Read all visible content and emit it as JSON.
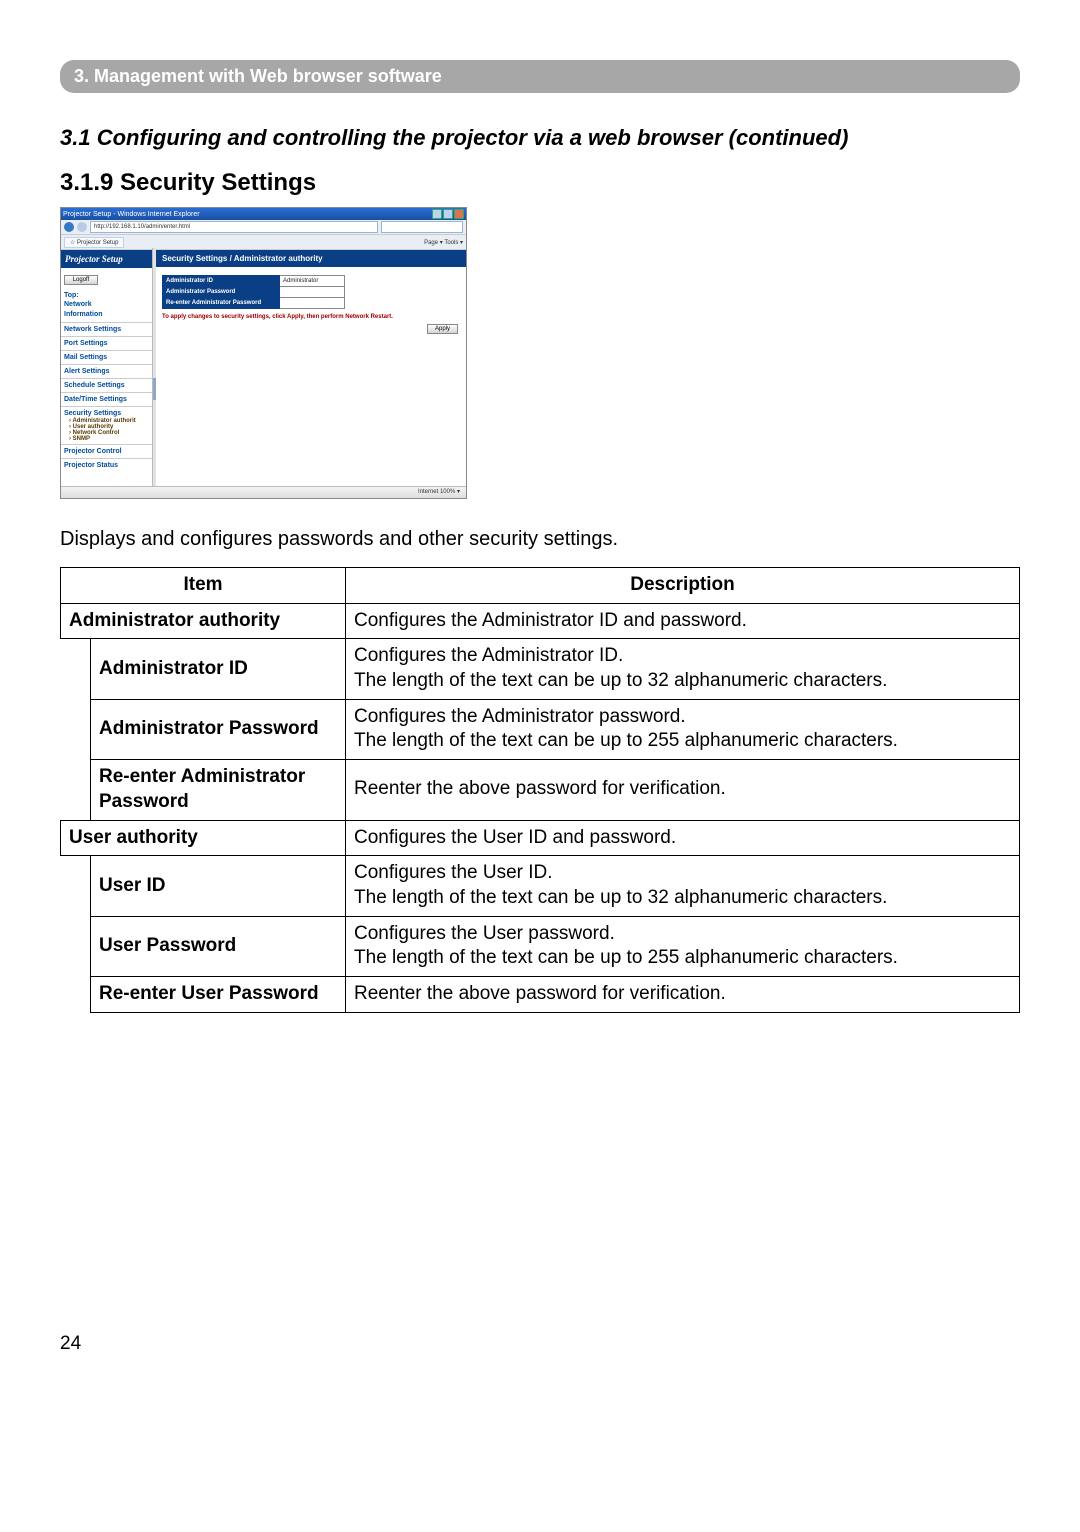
{
  "chapter": "3. Management with Web browser software",
  "section": "3.1 Configuring and controlling the projector via a web browser (continued)",
  "subsection": "3.1.9 Security Settings",
  "intro": "Displays and configures passwords and other security settings.",
  "page_number": "24",
  "table": {
    "head_item": "Item",
    "head_desc": "Description",
    "rows": {
      "admin_auth": {
        "item": "Administrator authority",
        "desc": "Configures the Administrator ID and password."
      },
      "admin_id": {
        "item": "Administrator ID",
        "desc": "Configures the Administrator ID.\nThe length of the text can be up to 32 alphanumeric characters."
      },
      "admin_pw": {
        "item": "Administrator Password",
        "desc": "Configures the Administrator password.\nThe length of the text can be up to 255 alphanumeric characters."
      },
      "admin_pw2": {
        "item": "Re-enter Administrator Password",
        "desc": "Reenter the above password for verification."
      },
      "user_auth": {
        "item": "User authority",
        "desc": "Configures the User ID and password."
      },
      "user_id": {
        "item": "User ID",
        "desc": "Configures the User ID.\nThe length of the text can be up to 32 alphanumeric characters."
      },
      "user_pw": {
        "item": "User Password",
        "desc": "Configures the User password.\nThe length of the text can be up to 255 alphanumeric characters."
      },
      "user_pw2": {
        "item": "Re-enter User Password",
        "desc": "Reenter the above password for verification."
      }
    }
  },
  "screenshot": {
    "title": "Projector Setup - Windows Internet Explorer",
    "url": "http://192.168.1.10/admin/enter.html",
    "tab": "Projector Setup",
    "toolbar_right": "Page ▾  Tools ▾",
    "side_brand": "Projector Setup",
    "logoff": "Logoff",
    "side": {
      "top": "Top:",
      "net": "Network",
      "info": "Information",
      "items": {
        "netset": "Network Settings",
        "port": "Port Settings",
        "mail": "Mail Settings",
        "alert": "Alert Settings",
        "sched": "Schedule Settings",
        "date": "Date/Time Settings",
        "sec": "Security Settings",
        "sub_admin": "› Administrator authorit",
        "sub_user": "› User authority",
        "sub_netctl": "› Network Control",
        "sub_snmp": "› SNMP",
        "projctl": "Projector Control",
        "projst": "Projector Status"
      }
    },
    "main": {
      "header": "Security Settings / Administrator authority",
      "rows": {
        "r1": "Administrator ID",
        "r1v": "Administrator",
        "r2": "Administrator Password",
        "r3": "Re-enter Administrator Password"
      },
      "note": "To apply changes to security settings, click Apply, then perform Network Restart.",
      "apply": "Apply"
    },
    "status": "Internet    100% ▾"
  }
}
